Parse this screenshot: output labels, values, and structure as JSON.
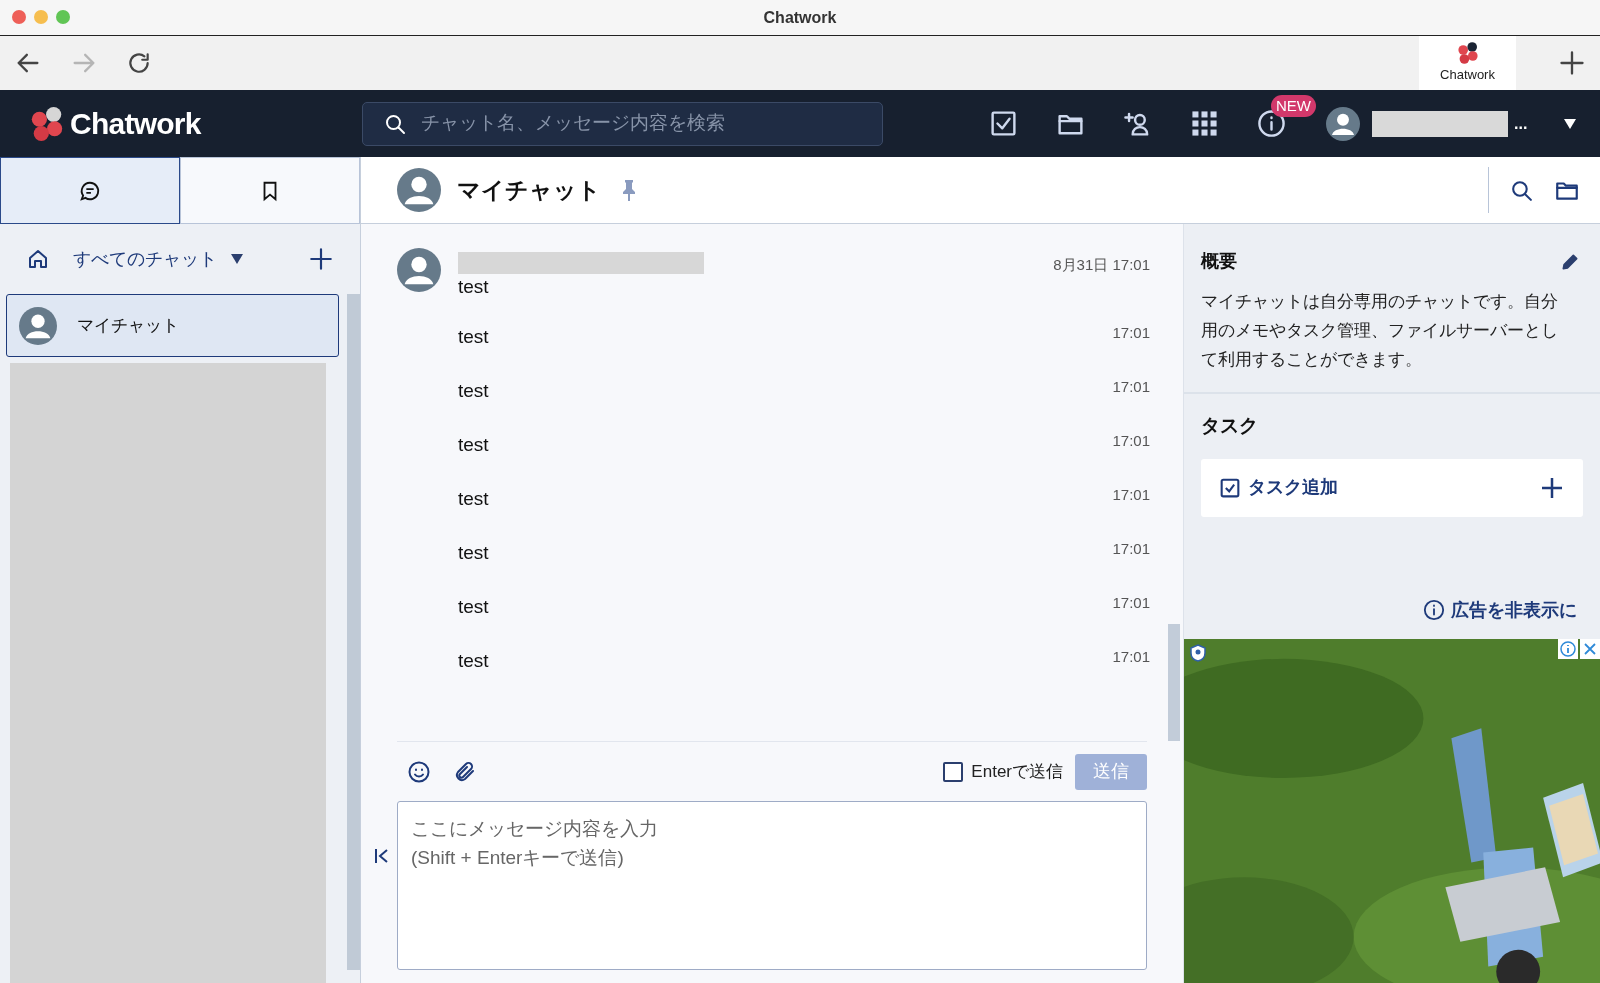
{
  "window": {
    "title": "Chatwork"
  },
  "browser": {
    "tabs": [
      {
        "label": "Chatwork",
        "selected": true
      }
    ]
  },
  "header": {
    "logo": "Chatwork",
    "search": {
      "placeholder": "チャット名、メッセージ内容を検索"
    },
    "news_badge": "NEW",
    "user_ellipsis": "..."
  },
  "sidebar": {
    "tabs": [
      {
        "kind": "chat",
        "selected": true
      },
      {
        "kind": "bookmark",
        "selected": false
      }
    ],
    "filter": "すべてのチャット",
    "rooms": [
      {
        "name": "マイチャット",
        "selected": true
      }
    ]
  },
  "room": {
    "title": "マイチャット"
  },
  "messages": [
    {
      "text": "test",
      "time": "8月31日 17:01",
      "first": true
    },
    {
      "text": "test",
      "time": "17:01",
      "first": false
    },
    {
      "text": "test",
      "time": "17:01",
      "first": false
    },
    {
      "text": "test",
      "time": "17:01",
      "first": false
    },
    {
      "text": "test",
      "time": "17:01",
      "first": false
    },
    {
      "text": "test",
      "time": "17:01",
      "first": false
    },
    {
      "text": "test",
      "time": "17:01",
      "first": false
    },
    {
      "text": "test",
      "time": "17:01",
      "first": false
    }
  ],
  "composer": {
    "enter_to_send": {
      "label": "Enterで送信",
      "checked": false
    },
    "send_button": {
      "label": "送信",
      "disabled": true
    },
    "placeholder": "ここにメッセージ内容を入力\n(Shift + Enterキーで送信)"
  },
  "overview": {
    "title": "概要",
    "text": "マイチャットは自分専用のチャットです。自分用のメモやタスク管理、ファイルサーバーとして利用することができます。"
  },
  "tasks": {
    "title": "タスク",
    "add_label": "タスク追加"
  },
  "hide_ads": "広告を非表示に"
}
